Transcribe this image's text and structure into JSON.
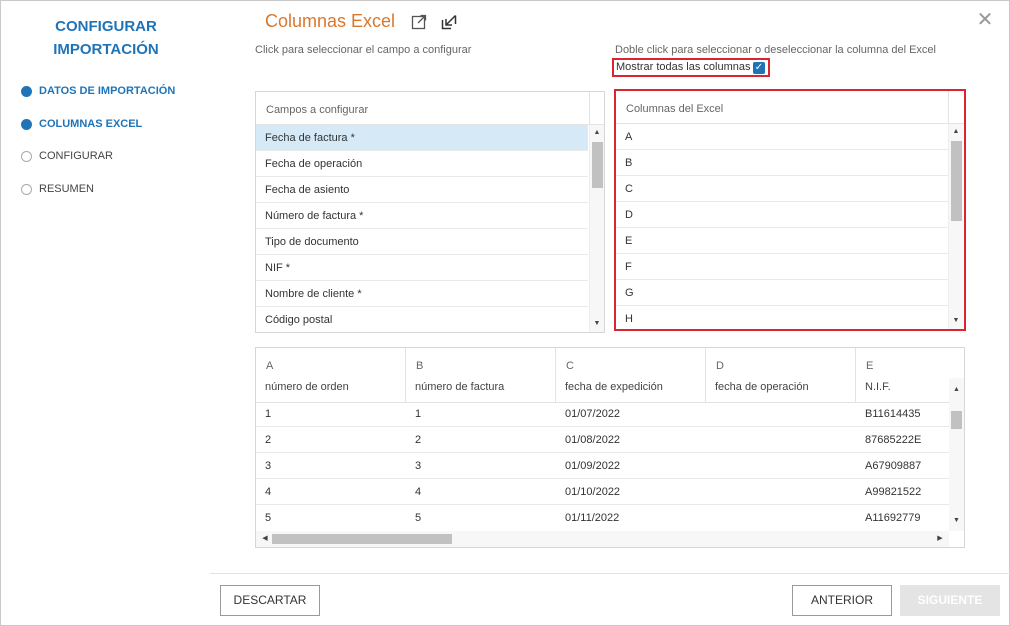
{
  "sidebar": {
    "title_line1": "CONFIGURAR",
    "title_line2": "IMPORTACIÓN",
    "steps": [
      {
        "label": "DATOS DE IMPORTACIÓN",
        "state": "done"
      },
      {
        "label": "COLUMNAS EXCEL",
        "state": "done"
      },
      {
        "label": "CONFIGURAR",
        "state": "pending"
      },
      {
        "label": "RESUMEN",
        "state": "pending"
      }
    ]
  },
  "header": {
    "title": "Columnas Excel",
    "close_glyph": "✕"
  },
  "hints": {
    "left": "Click para seleccionar el campo a configurar",
    "right": "Doble click para seleccionar o deseleccionar la columna del Excel",
    "show_all_label": "Mostrar todas las columnas",
    "show_all_checked": true
  },
  "fields_list": {
    "header": "Campos a configurar",
    "items": [
      "Fecha de factura *",
      "Fecha de operación",
      "Fecha de asiento",
      "Número de factura *",
      "Tipo de documento",
      "NIF *",
      "Nombre de cliente *",
      "Código postal"
    ],
    "selected_index": 0
  },
  "excel_list": {
    "header": "Columnas del Excel",
    "items": [
      "A",
      "B",
      "C",
      "D",
      "E",
      "F",
      "G",
      "H"
    ]
  },
  "preview": {
    "columns": [
      {
        "letter": "A",
        "name": "número de orden"
      },
      {
        "letter": "B",
        "name": "número de factura"
      },
      {
        "letter": "C",
        "name": "fecha de expedición"
      },
      {
        "letter": "D",
        "name": "fecha de operación"
      },
      {
        "letter": "E",
        "name": "N.I.F."
      }
    ],
    "rows": [
      [
        "1",
        "1",
        "01/07/2022",
        "",
        "B11614435"
      ],
      [
        "2",
        "2",
        "01/08/2022",
        "",
        "87685222E"
      ],
      [
        "3",
        "3",
        "01/09/2022",
        "",
        "A67909887"
      ],
      [
        "4",
        "4",
        "01/10/2022",
        "",
        "A99821522"
      ],
      [
        "5",
        "5",
        "01/11/2022",
        "",
        "A11692779"
      ]
    ]
  },
  "footer": {
    "discard": "DESCARTAR",
    "previous": "ANTERIOR",
    "next": "SIGUIENTE"
  },
  "colors": {
    "accent": "#1f74b8",
    "title": "#d9782d",
    "highlight": "#d9252f",
    "selected_row": "#d5e9f7"
  }
}
